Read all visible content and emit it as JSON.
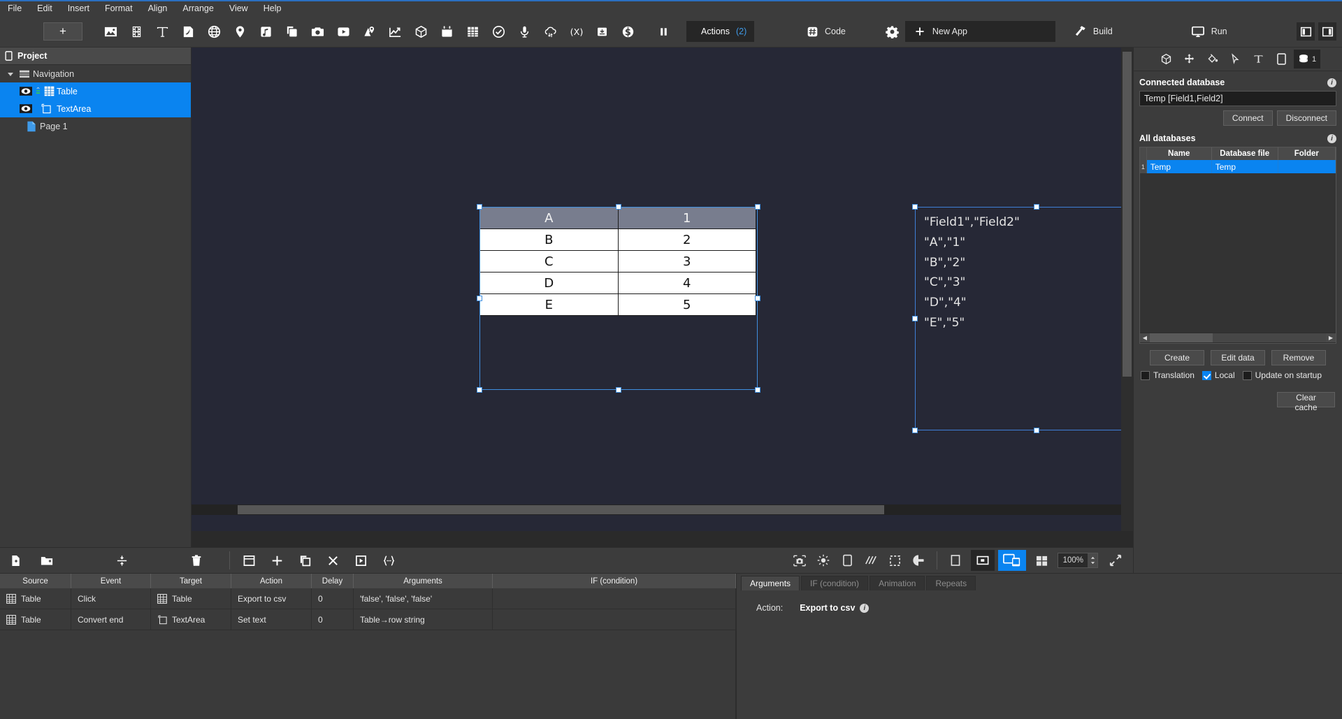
{
  "menubar": {
    "items": [
      "File",
      "Edit",
      "Insert",
      "Format",
      "Align",
      "Arrange",
      "View",
      "Help"
    ]
  },
  "toolbar": {
    "add_label": "+",
    "icons": [
      {
        "name": "image-icon"
      },
      {
        "name": "film-icon"
      },
      {
        "name": "text-icon"
      },
      {
        "name": "pdf-icon"
      },
      {
        "name": "globe-icon"
      },
      {
        "name": "map-pin-icon"
      },
      {
        "name": "music-icon"
      },
      {
        "name": "layers-icon"
      },
      {
        "name": "camera-icon"
      },
      {
        "name": "video-player-icon"
      },
      {
        "name": "map-route-icon"
      },
      {
        "name": "chart-line-icon"
      },
      {
        "name": "cube-3d-icon"
      },
      {
        "name": "calendar-icon"
      },
      {
        "name": "table-grid-icon"
      },
      {
        "name": "check-circle-icon"
      },
      {
        "name": "microphone-icon"
      },
      {
        "name": "cloud-sync-icon"
      },
      {
        "name": "variable-icon"
      },
      {
        "name": "download-box-icon"
      },
      {
        "name": "dollar-icon"
      },
      {
        "name": "pause-icon"
      }
    ],
    "actions_label": "Actions",
    "actions_count": "(2)",
    "code_label": "Code",
    "settings_icon": "gear-icon",
    "new_app_label": "New App",
    "build_label": "Build",
    "run_label": "Run",
    "layout_left_icon": "layout-left-icon",
    "layout_right_icon": "layout-right-icon"
  },
  "project_panel": {
    "title": "Project",
    "tree": [
      {
        "label": "Navigation",
        "depth": 0,
        "icon": "navigation-icon",
        "selected": false,
        "expander": true,
        "eye": false
      },
      {
        "label": "Table",
        "depth": 1,
        "icon": "table-grid-icon",
        "selected": true,
        "expander": false,
        "eye": true
      },
      {
        "label": "TextArea",
        "depth": 1,
        "icon": "textarea-icon",
        "selected": true,
        "expander": false,
        "eye": true
      },
      {
        "label": "Page 1",
        "depth": 1,
        "icon": "page-icon",
        "selected": false,
        "expander": false,
        "eye": false
      }
    ]
  },
  "canvas": {
    "table_widget": {
      "name": "Table",
      "header": [
        "A",
        "1"
      ],
      "rows": [
        [
          "B",
          "2"
        ],
        [
          "C",
          "3"
        ],
        [
          "D",
          "4"
        ],
        [
          "E",
          "5"
        ]
      ]
    },
    "textarea_widget": {
      "name": "TextArea",
      "text": "\"Field1\",\"Field2\"\n\"A\",\"1\"\n\"B\",\"2\"\n\"C\",\"3\"\n\"D\",\"4\"\n\"E\",\"5\""
    }
  },
  "canvas_bar": {
    "icons_left": [
      {
        "name": "new-file-icon"
      },
      {
        "name": "new-folder-icon"
      },
      {
        "name": "distribute-vertical-icon"
      },
      {
        "name": "delete-icon"
      }
    ],
    "icons_mid": [
      {
        "name": "window-icon"
      },
      {
        "name": "add-icon"
      },
      {
        "name": "duplicate-icon"
      },
      {
        "name": "close-icon"
      },
      {
        "name": "play-box-icon"
      },
      {
        "name": "braces-icon"
      }
    ],
    "icons_right": [
      {
        "name": "screenshot-icon"
      },
      {
        "name": "brightness-icon"
      },
      {
        "name": "device-icon"
      },
      {
        "name": "hatch-icon"
      },
      {
        "name": "marquee-select-icon"
      },
      {
        "name": "contrast-icon"
      }
    ],
    "view_modes": [
      {
        "name": "portrait-view-icon",
        "active": false
      },
      {
        "name": "landscape-view-icon",
        "active": false
      },
      {
        "name": "dual-device-view-icon",
        "active": true
      },
      {
        "name": "windows-view-icon",
        "active": false
      }
    ],
    "zoom_value": "100%",
    "fit_icon": "fit-screen-icon"
  },
  "right_panel": {
    "tabs": [
      {
        "name": "cube-3d-icon",
        "active": false,
        "badge": ""
      },
      {
        "name": "move-icon",
        "active": false,
        "badge": ""
      },
      {
        "name": "fill-bucket-icon",
        "active": false,
        "badge": ""
      },
      {
        "name": "cursor-icon",
        "active": false,
        "badge": ""
      },
      {
        "name": "text-icon",
        "active": false,
        "badge": ""
      },
      {
        "name": "device-icon",
        "active": false,
        "badge": ""
      },
      {
        "name": "database-icon",
        "active": true,
        "badge": "1"
      }
    ],
    "connected_database_title": "Connected database",
    "connected_database_value": "Temp [Field1,Field2]",
    "connect_label": "Connect",
    "disconnect_label": "Disconnect",
    "all_databases_title": "All databases",
    "db_columns": [
      "Name",
      "Database file",
      "Folder"
    ],
    "db_rows": [
      {
        "index": "1",
        "name": "Temp",
        "file": "Temp",
        "folder": ""
      }
    ],
    "create_label": "Create",
    "edit_data_label": "Edit data",
    "remove_label": "Remove",
    "checkboxes": [
      {
        "label": "Translation",
        "checked": false
      },
      {
        "label": "Local",
        "checked": true
      },
      {
        "label": "Update on startup",
        "checked": false
      }
    ],
    "clear_cache_label": "Clear cache"
  },
  "actions_grid": {
    "columns": [
      "Source",
      "Event",
      "Target",
      "Action",
      "Delay",
      "Arguments",
      "IF (condition)"
    ],
    "rows": [
      {
        "source": "Table",
        "source_icon": "table-grid-icon",
        "event": "Click",
        "target": "Table",
        "target_icon": "table-grid-icon",
        "action": "Export to csv",
        "delay": "0",
        "arguments": "'false', 'false', 'false'",
        "condition": ""
      },
      {
        "source": "Table",
        "source_icon": "table-grid-icon",
        "event": "Convert end",
        "target": "TextArea",
        "target_icon": "textarea-icon",
        "action": "Set text",
        "delay": "0",
        "arguments": "Table→row string",
        "condition": ""
      }
    ]
  },
  "arguments_panel": {
    "tabs": [
      {
        "label": "Arguments",
        "active": true
      },
      {
        "label": "IF (condition)",
        "active": false
      },
      {
        "label": "Animation",
        "active": false
      },
      {
        "label": "Repeats",
        "active": false
      }
    ],
    "action_label": "Action:",
    "action_value": "Export to csv"
  },
  "colors": {
    "accent": "#0a84f0",
    "panel": "#3c3c3c",
    "canvas": "#262836",
    "selection": "#3f8fe0"
  }
}
